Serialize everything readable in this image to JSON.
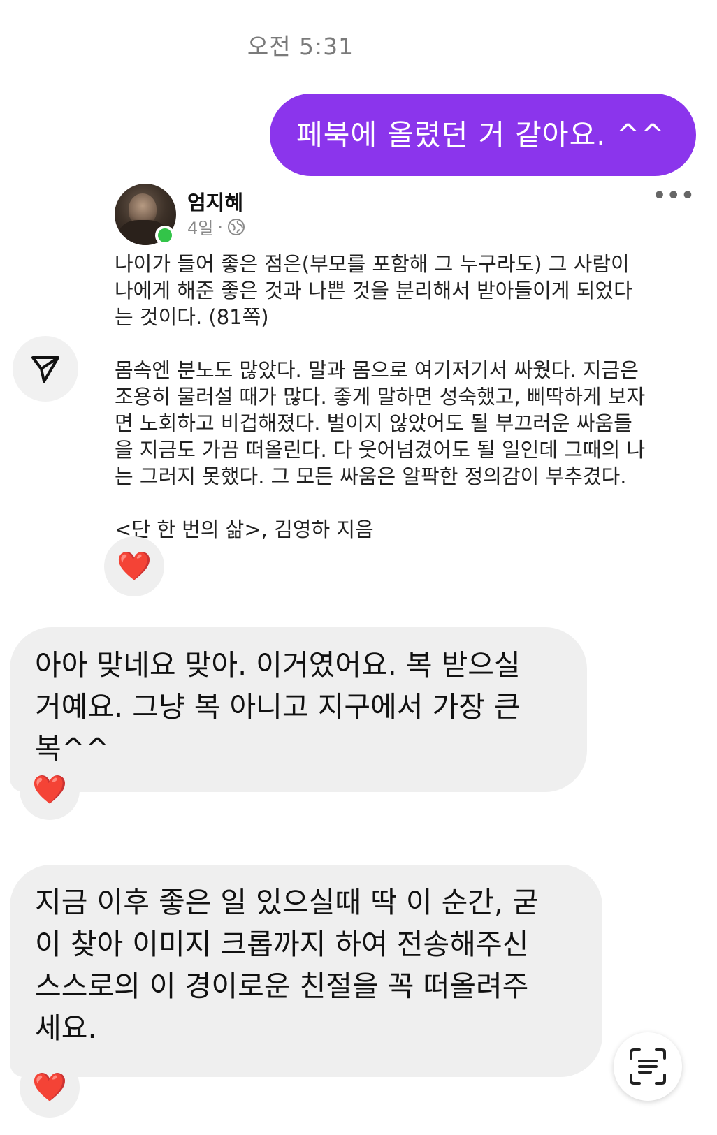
{
  "timestamp": "오전 5:31",
  "outgoing_message": "페북에 올렸던 거 같아요. ^^",
  "shared_post": {
    "author": "엄지혜",
    "age": "4일",
    "separator": "·",
    "visibility_icon": "globe-icon",
    "more_icon": "•••",
    "body": "나이가 들어 좋은 점은(부모를 포함해 그 누구라도) 그 사람이\n나에게 해준 좋은 것과 나쁜 것을 분리해서 받아들이게 되었다\n는 것이다. (81쪽)\n\n몸속엔 분노도 많았다. 말과 몸으로 여기저기서 싸웠다. 지금은\n조용히 물러설 때가 많다. 좋게 말하면 성숙했고, 삐딱하게 보자\n면 노회하고 비겁해졌다. 벌이지 않았어도 될 부끄러운 싸움들\n을 지금도 가끔 떠올린다. 다 웃어넘겼어도 될 일인데 그때의 나\n는 그러지 못했다. 그 모든 싸움은 알팍한 정의감이 부추겼다.\n\n<단 한 번의 삶>, 김영하 지음",
    "reaction": "❤️"
  },
  "incoming_messages": [
    {
      "text": "아아 맞네요 맞아. 이거였어요. 복 받으실\n거예요. 그냥 복 아니고 지구에서 가장 큰\n복^^",
      "reaction": "❤️"
    },
    {
      "text": "지금 이후 좋은 일 있으실때 딱 이 순간, 굳\n이 찾아 이미지 크롭까지 하여 전송해주신\n스스로의 이 경이로운 친절을 꼭 떠올려주\n세요.",
      "reaction": "❤️"
    }
  ],
  "icons": {
    "send": "send-icon",
    "scan": "text-scan-icon"
  },
  "colors": {
    "outgoing_bubble": "#8b35ec",
    "incoming_bubble": "#efefef",
    "heart": "#e0141f",
    "online": "#33c449"
  }
}
